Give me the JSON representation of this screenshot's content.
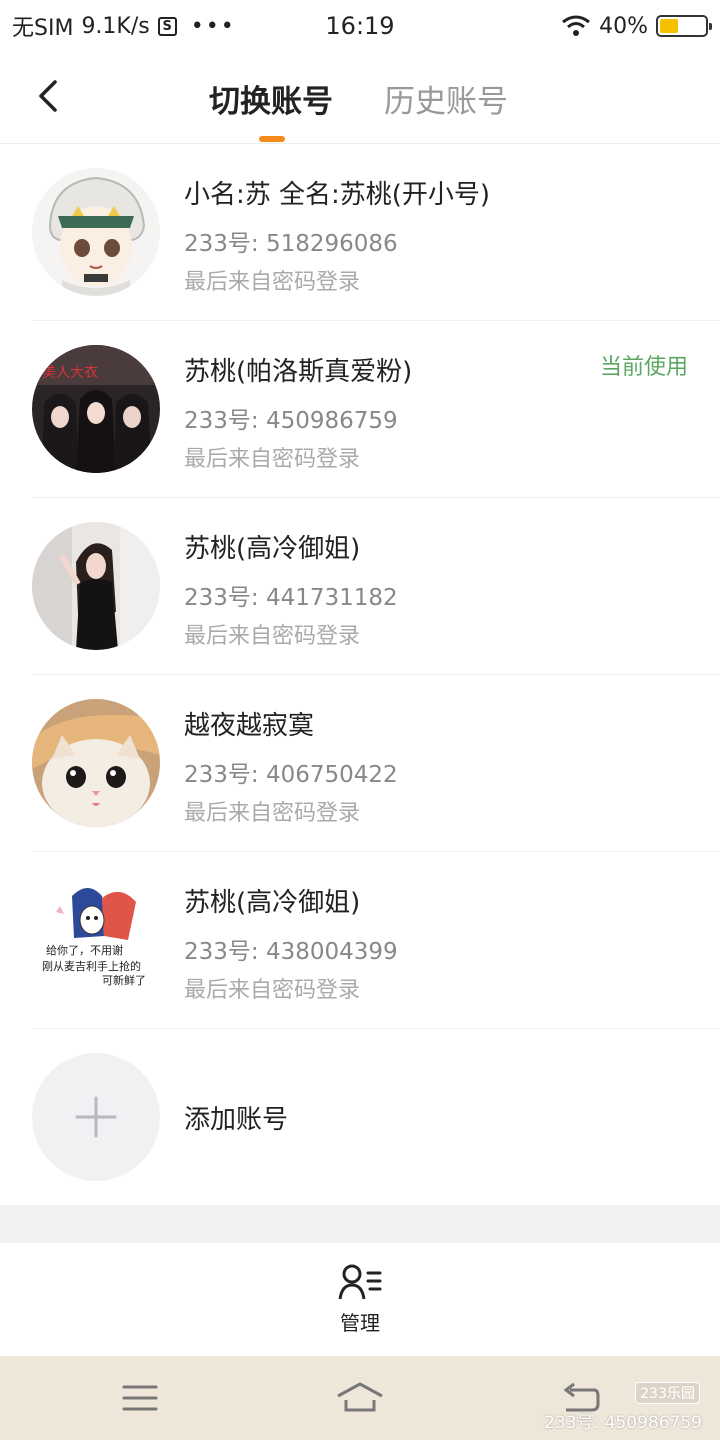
{
  "status_bar": {
    "carrier": "无SIM",
    "speed": "9.1K/s",
    "s_icon": "S",
    "dots": "•••",
    "time": "16:19",
    "battery": "40%",
    "battery_level": 0.4
  },
  "header": {
    "tabs": [
      {
        "label": "切换账号",
        "active": true
      },
      {
        "label": "历史账号",
        "active": false
      }
    ],
    "accent_color": "#f28b1c"
  },
  "accounts": [
    {
      "name": "小名:苏 全名:苏桃(开小号)",
      "id": "233号: 518296086",
      "login": "最后来自密码登录",
      "badge": "",
      "avatar": "anime-character-avatar"
    },
    {
      "name": "苏桃(帕洛斯真爱粉)",
      "id": "233号: 450986759",
      "login": "最后来自密码登录",
      "badge": "当前使用",
      "avatar": "group-photo-avatar"
    },
    {
      "name": "苏桃(高冷御姐)",
      "id": "233号: 441731182",
      "login": "最后来自密码登录",
      "badge": "",
      "avatar": "portrait-photo-avatar"
    },
    {
      "name": "越夜越寂寞",
      "id": "233号: 406750422",
      "login": "最后来自密码登录",
      "badge": "",
      "avatar": "kitten-avatar"
    },
    {
      "name": "苏桃(高冷御姐)",
      "id": "233号: 438004399",
      "login": "最后来自密码登录",
      "badge": "",
      "avatar": "cartoon-sticker-avatar"
    }
  ],
  "avatar_texts": {
    "sticker_line1": "给你了，不用谢",
    "sticker_line2": "刚从麦吉利手上抢的",
    "sticker_line3": "可新鲜了"
  },
  "add_account": {
    "label": "添加账号"
  },
  "manage": {
    "label": "管理"
  },
  "nav_bar": {
    "watermark_logo": "233乐园",
    "watermark_text": "233号: 450986759"
  },
  "colors": {
    "current_badge": "#5aa764",
    "nav_bar_bg": "#efe6da"
  }
}
